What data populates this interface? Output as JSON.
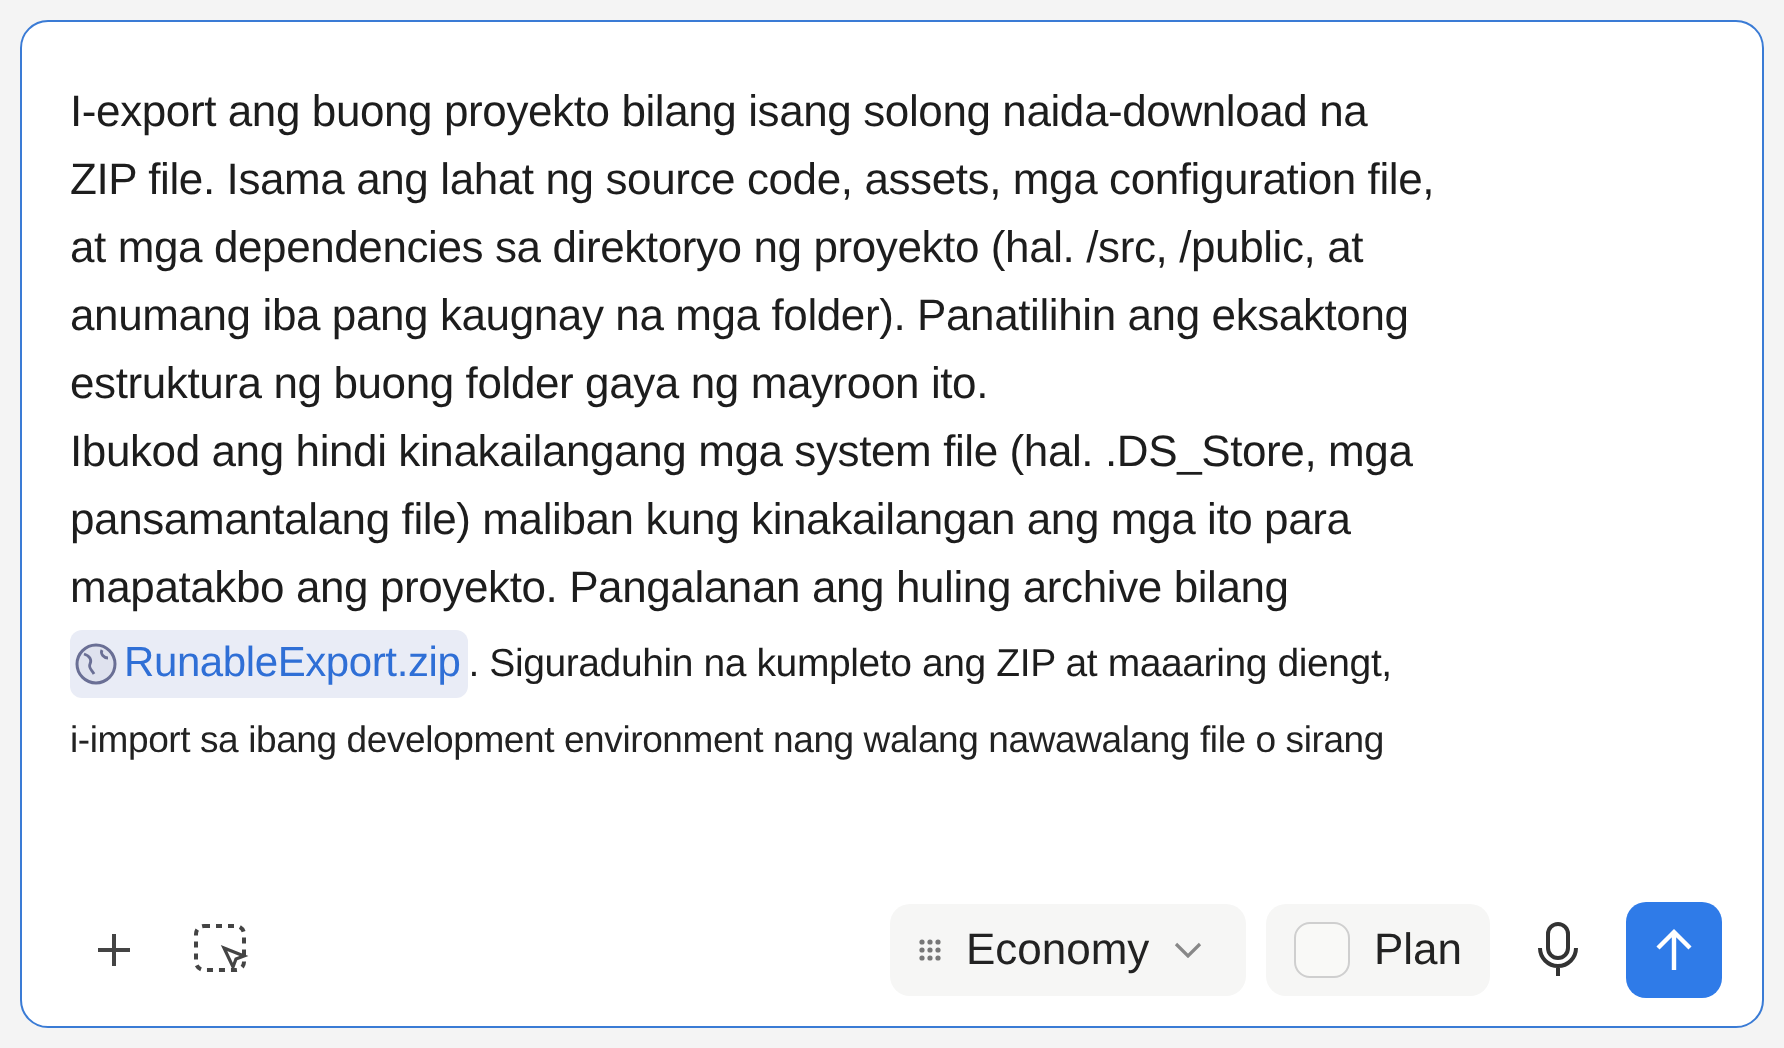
{
  "prompt": {
    "lines": [
      {
        "kind": "normal",
        "text": "I-export ang buong proyekto bilang isang solong naida-download na"
      },
      {
        "kind": "normal",
        "text": "ZIP file. Isama ang lahat ng source code, assets, mga configuration file,"
      },
      {
        "kind": "normal",
        "text": "at mga dependencies sa direktoryo ng proyekto (hal. /src, /public, at"
      },
      {
        "kind": "normal",
        "text": "anumang iba pang kaugnay na mga folder). Panatilihin ang eksaktong"
      },
      {
        "kind": "normal",
        "text": "estruktura ng buong folder gaya ng mayroon ito."
      },
      {
        "kind": "normal",
        "text": "Ibukod ang hindi kinakailangang mga system file (hal. .DS_Store, mga"
      },
      {
        "kind": "normal",
        "text": "pansamantalang file) maliban kung kinakailangan ang mga ito para"
      },
      {
        "kind": "normal",
        "text": "mapatakbo ang proyekto. Pangalanan ang huling archive bilang"
      },
      {
        "kind": "chip",
        "chip": "RunableExport.zip",
        "text": ". Siguraduhin na kumpleto ang ZIP at maaaring diengt,"
      },
      {
        "kind": "small",
        "text": "i-import sa ibang development environment nang walang nawawalang file o sirang"
      }
    ]
  },
  "toolbar": {
    "model": {
      "label": "Economy"
    },
    "plan": {
      "label": "Plan",
      "checked": false
    }
  }
}
